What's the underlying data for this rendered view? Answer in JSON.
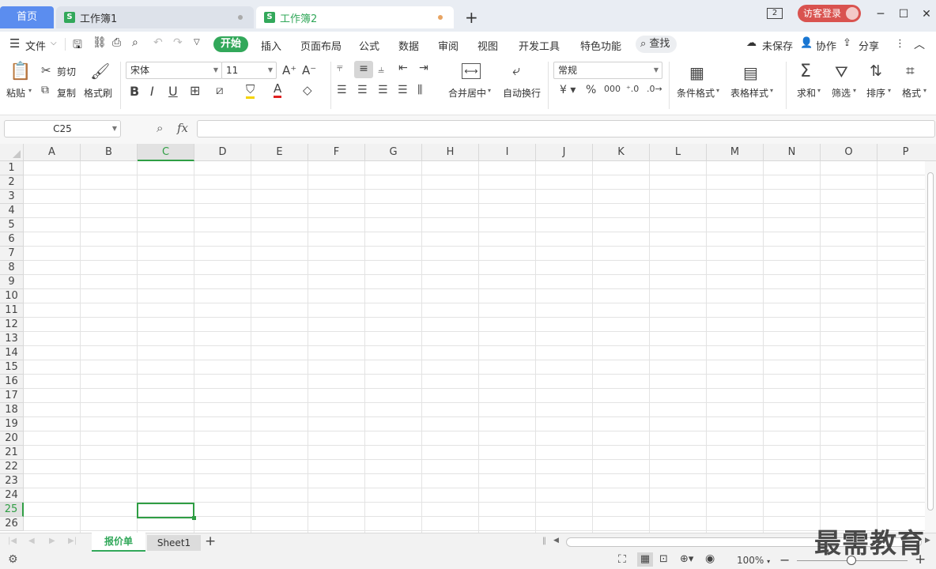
{
  "tabs": {
    "home": "首页",
    "doc1": "工作簿1",
    "doc2": "工作簿2",
    "doc_icon": "S",
    "login": "访客登录",
    "window_badge": "2"
  },
  "menu": {
    "file": "文件",
    "items": [
      "开始",
      "插入",
      "页面布局",
      "公式",
      "数据",
      "审阅",
      "视图",
      "开发工具",
      "特色功能"
    ],
    "search": "查找",
    "unsaved": "未保存",
    "collab": "协作",
    "share": "分享"
  },
  "ribbon": {
    "paste": "粘贴",
    "cut": "剪切",
    "copy": "复制",
    "format_painter": "格式刷",
    "font_name": "宋体",
    "font_size": "11",
    "merge_center": "合并居中",
    "wrap_text": "自动换行",
    "number_format": "常规",
    "cond_format": "条件格式",
    "table_style": "表格样式",
    "sum": "求和",
    "filter": "筛选",
    "sort": "排序",
    "format": "格式"
  },
  "formula_bar": {
    "name_box": "C25",
    "fx": "fx",
    "content": ""
  },
  "grid": {
    "columns": [
      "A",
      "B",
      "C",
      "D",
      "E",
      "F",
      "G",
      "H",
      "I",
      "J",
      "K",
      "L",
      "M",
      "N",
      "O",
      "P"
    ],
    "rows": [
      "1",
      "2",
      "3",
      "4",
      "5",
      "6",
      "7",
      "8",
      "9",
      "10",
      "11",
      "12",
      "13",
      "14",
      "15",
      "16",
      "17",
      "18",
      "19",
      "20",
      "21",
      "22",
      "23",
      "24",
      "25",
      "26"
    ],
    "selected_cell": "C25"
  },
  "sheets": {
    "tabs": [
      "报价单",
      "Sheet1"
    ],
    "active": "报价单"
  },
  "status": {
    "zoom": "100%"
  },
  "watermark": "最需教育",
  "colors": {
    "accent_green": "#32a85a",
    "home_tab_blue": "#5b8def",
    "login_red": "#d9534f"
  }
}
